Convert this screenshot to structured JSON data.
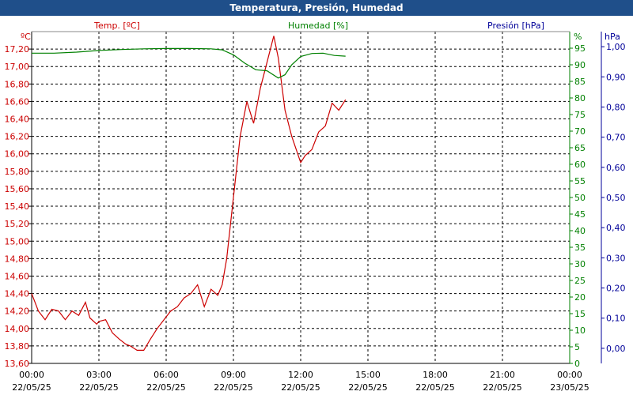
{
  "window": {
    "title": "Temperatura, Presión, Humedad"
  },
  "colors": {
    "temp": "#cc0000",
    "hum": "#008000",
    "pres": "#000099",
    "grid": "#000000",
    "title_bg": "#1f4f8a"
  },
  "chart_data": {
    "type": "line",
    "title": "Temperatura, Presión, Humedad",
    "grid": true,
    "x_ticks": [
      {
        "time": "00:00",
        "date": "22/05/25"
      },
      {
        "time": "03:00",
        "date": "22/05/25"
      },
      {
        "time": "06:00",
        "date": "22/05/25"
      },
      {
        "time": "09:00",
        "date": "22/05/25"
      },
      {
        "time": "12:00",
        "date": "22/05/25"
      },
      {
        "time": "15:00",
        "date": "22/05/25"
      },
      {
        "time": "18:00",
        "date": "22/05/25"
      },
      {
        "time": "21:00",
        "date": "22/05/25"
      },
      {
        "time": "00:00",
        "date": "23/05/25"
      }
    ],
    "x_range_hours": [
      0,
      24
    ],
    "axes": {
      "temp": {
        "label": "Temp. [ºC]",
        "unit": "ºC",
        "range": [
          13.6,
          17.4
        ],
        "ticks": [
          "13,60",
          "13,80",
          "14,00",
          "14,20",
          "14,40",
          "14,60",
          "14,80",
          "15,00",
          "15,20",
          "15,40",
          "15,60",
          "15,80",
          "16,00",
          "16,20",
          "16,40",
          "16,60",
          "16,80",
          "17,00",
          "17,20"
        ]
      },
      "hum": {
        "label": "Humedad [%]",
        "unit": "%",
        "range": [
          0,
          100
        ],
        "ticks": [
          "0",
          "5",
          "10",
          "15",
          "20",
          "25",
          "30",
          "35",
          "40",
          "45",
          "50",
          "55",
          "60",
          "65",
          "70",
          "75",
          "80",
          "85",
          "90",
          "95"
        ]
      },
      "pres": {
        "label": "Presión [hPa]",
        "unit": "hPa",
        "range": [
          -0.05,
          1.05
        ],
        "ticks": [
          "0,00",
          "0,10",
          "0,20",
          "0,30",
          "0,40",
          "0,50",
          "0,60",
          "0,70",
          "0,80",
          "0,90",
          "1,00"
        ]
      }
    },
    "series": [
      {
        "name": "Temp. [ºC]",
        "axis": "temp",
        "x_hours": [
          0,
          0.3,
          0.6,
          0.9,
          1.2,
          1.5,
          1.8,
          2.1,
          2.4,
          2.6,
          2.9,
          3.0,
          3.3,
          3.6,
          3.9,
          4.2,
          4.4,
          4.7,
          5.0,
          5.3,
          5.6,
          5.9,
          6.2,
          6.5,
          6.8,
          7.1,
          7.4,
          7.7,
          8.0,
          8.3,
          8.5,
          8.7,
          9.0,
          9.3,
          9.6,
          9.9,
          10.2,
          10.5,
          10.8,
          11.0,
          11.3,
          11.6,
          12.0,
          12.2,
          12.5,
          12.8,
          13.1,
          13.4,
          13.7,
          14.0
        ],
        "y": [
          14.4,
          14.2,
          14.1,
          14.22,
          14.2,
          14.1,
          14.2,
          14.15,
          14.3,
          14.12,
          14.05,
          14.08,
          14.1,
          13.95,
          13.88,
          13.82,
          13.8,
          13.75,
          13.75,
          13.88,
          14.0,
          14.1,
          14.2,
          14.25,
          14.35,
          14.4,
          14.5,
          14.25,
          14.45,
          14.38,
          14.5,
          14.8,
          15.5,
          16.2,
          16.6,
          16.35,
          16.75,
          17.05,
          17.35,
          17.1,
          16.5,
          16.2,
          15.9,
          15.98,
          16.05,
          16.25,
          16.32,
          16.58,
          16.5,
          16.62
        ]
      },
      {
        "name": "Humedad [%]",
        "axis": "hum",
        "x_hours": [
          0,
          1.0,
          2.0,
          3.0,
          4.0,
          5.0,
          6.0,
          7.0,
          8.0,
          8.5,
          9.0,
          9.5,
          10.0,
          10.5,
          11.0,
          11.3,
          11.6,
          12.0,
          12.5,
          13.0,
          13.5,
          14.0
        ],
        "y": [
          93.5,
          93.5,
          93.8,
          94.3,
          94.6,
          94.8,
          94.9,
          94.9,
          94.8,
          94.5,
          93.0,
          90.5,
          88.5,
          88.2,
          86.0,
          87.0,
          90.0,
          92.5,
          93.4,
          93.5,
          92.8,
          92.6
        ]
      }
    ]
  }
}
